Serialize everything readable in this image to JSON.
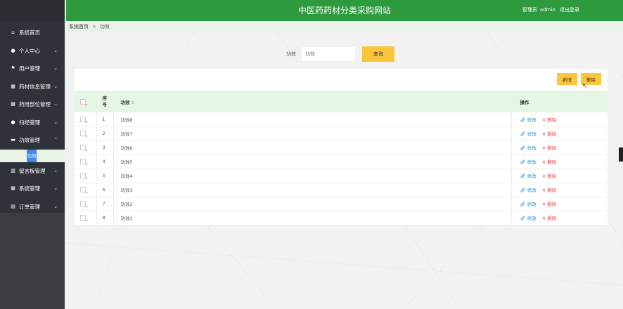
{
  "header": {
    "site_title": "中医药药材分类采购网站",
    "user_role": "管理员",
    "user_name": "admin",
    "logout_label": "退出登录",
    "bg_color": "#2e9a3e"
  },
  "sidebar": {
    "items": [
      {
        "label": "系统首页",
        "icon": "home-icon",
        "glyph": "⌂",
        "has_chevron": false
      },
      {
        "label": "个人中心",
        "icon": "user-icon",
        "glyph": "●",
        "has_chevron": true
      },
      {
        "label": "用户管理",
        "icon": "flag-icon",
        "glyph": "⚑",
        "has_chevron": true
      },
      {
        "label": "药材信息管理",
        "icon": "grid-icon",
        "glyph": "▦",
        "has_chevron": true
      },
      {
        "label": "药用部位管理",
        "icon": "grid-icon",
        "glyph": "▦",
        "has_chevron": true
      },
      {
        "label": "归经管理",
        "icon": "user-icon",
        "glyph": "●",
        "has_chevron": true
      },
      {
        "label": "功效管理",
        "icon": "doc-icon",
        "glyph": "▬",
        "has_chevron": true,
        "expanded": true
      },
      {
        "label": "留言板管理",
        "icon": "chart-icon",
        "glyph": "▥",
        "has_chevron": true
      },
      {
        "label": "系统管理",
        "icon": "grid-icon",
        "glyph": "▦",
        "has_chevron": true
      },
      {
        "label": "订单管理",
        "icon": "list-icon",
        "glyph": "▤",
        "has_chevron": true
      }
    ],
    "submenu_active": "功效"
  },
  "breadcrumb": {
    "home": "系统首页",
    "separator": ">",
    "current": "功效"
  },
  "search": {
    "label": "功效",
    "placeholder": "功效",
    "button_label": "查询"
  },
  "toolbar": {
    "add_label": "新增",
    "delete_label": "删除"
  },
  "table": {
    "headers": {
      "index": "序号",
      "name": "功效",
      "operations": "操作"
    },
    "edit_label": "修改",
    "delete_label": "删除",
    "rows": [
      {
        "index": "1",
        "name": "功效8"
      },
      {
        "index": "2",
        "name": "功效7"
      },
      {
        "index": "3",
        "name": "功效6"
      },
      {
        "index": "4",
        "name": "功效5"
      },
      {
        "index": "5",
        "name": "功效4"
      },
      {
        "index": "6",
        "name": "功效3"
      },
      {
        "index": "7",
        "name": "功效2"
      },
      {
        "index": "8",
        "name": "功效1"
      }
    ]
  },
  "colors": {
    "accent_yellow": "#fdc63a",
    "header_green": "#2e9a3e",
    "table_head_green": "#e6f6e4",
    "sidebar_dark": "#2f3339",
    "edit_blue": "#2b8cc4",
    "delete_red": "#e04b4b"
  }
}
